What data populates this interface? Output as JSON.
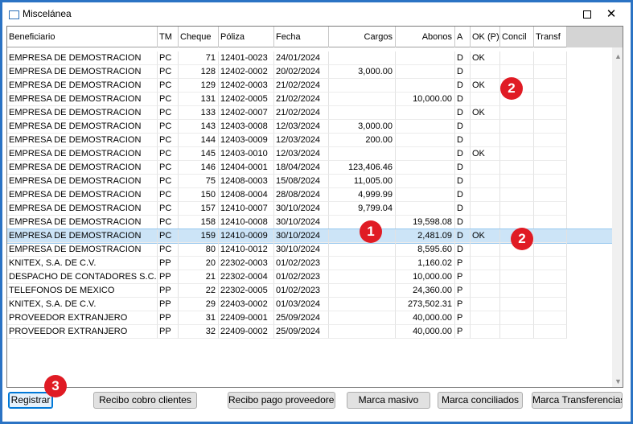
{
  "window": {
    "title": "Miscelánea",
    "maximize_icon": "maximize-icon",
    "close_label": "✕"
  },
  "table": {
    "columns": [
      "Beneficiario",
      "TM",
      "Cheque",
      "Póliza",
      "Fecha",
      "Cargos",
      "Abonos",
      "A",
      "OK (P)",
      "Concil",
      "Transf"
    ],
    "selected_row": 13,
    "rows": [
      {
        "beneficiario": "EMPRESA DE DEMOSTRACION",
        "tm": "PC",
        "cheque": "71",
        "poliza": "12401-0023",
        "fecha": "24/01/2024",
        "cargos": "",
        "abonos": "",
        "a": "D",
        "ok": "OK"
      },
      {
        "beneficiario": "EMPRESA DE DEMOSTRACION",
        "tm": "PC",
        "cheque": "128",
        "poliza": "12402-0002",
        "fecha": "20/02/2024",
        "cargos": "3,000.00",
        "abonos": "",
        "a": "D",
        "ok": ""
      },
      {
        "beneficiario": "EMPRESA DE DEMOSTRACION",
        "tm": "PC",
        "cheque": "129",
        "poliza": "12402-0003",
        "fecha": "21/02/2024",
        "cargos": "",
        "abonos": "",
        "a": "D",
        "ok": "OK"
      },
      {
        "beneficiario": "EMPRESA DE DEMOSTRACION",
        "tm": "PC",
        "cheque": "131",
        "poliza": "12402-0005",
        "fecha": "21/02/2024",
        "cargos": "",
        "abonos": "10,000.00",
        "a": "D",
        "ok": ""
      },
      {
        "beneficiario": "EMPRESA DE DEMOSTRACION",
        "tm": "PC",
        "cheque": "133",
        "poliza": "12402-0007",
        "fecha": "21/02/2024",
        "cargos": "",
        "abonos": "",
        "a": "D",
        "ok": "OK"
      },
      {
        "beneficiario": "EMPRESA DE DEMOSTRACION",
        "tm": "PC",
        "cheque": "143",
        "poliza": "12403-0008",
        "fecha": "12/03/2024",
        "cargos": "3,000.00",
        "abonos": "",
        "a": "D",
        "ok": ""
      },
      {
        "beneficiario": "EMPRESA DE DEMOSTRACION",
        "tm": "PC",
        "cheque": "144",
        "poliza": "12403-0009",
        "fecha": "12/03/2024",
        "cargos": "200.00",
        "abonos": "",
        "a": "D",
        "ok": ""
      },
      {
        "beneficiario": "EMPRESA DE DEMOSTRACION",
        "tm": "PC",
        "cheque": "145",
        "poliza": "12403-0010",
        "fecha": "12/03/2024",
        "cargos": "",
        "abonos": "",
        "a": "D",
        "ok": "OK"
      },
      {
        "beneficiario": "EMPRESA DE DEMOSTRACION",
        "tm": "PC",
        "cheque": "146",
        "poliza": "12404-0001",
        "fecha": "18/04/2024",
        "cargos": "123,406.46",
        "abonos": "",
        "a": "D",
        "ok": ""
      },
      {
        "beneficiario": "EMPRESA DE DEMOSTRACION",
        "tm": "PC",
        "cheque": "75",
        "poliza": "12408-0003",
        "fecha": "15/08/2024",
        "cargos": "11,005.00",
        "abonos": "",
        "a": "D",
        "ok": ""
      },
      {
        "beneficiario": "EMPRESA DE DEMOSTRACION",
        "tm": "PC",
        "cheque": "150",
        "poliza": "12408-0004",
        "fecha": "28/08/2024",
        "cargos": "4,999.99",
        "abonos": "",
        "a": "D",
        "ok": ""
      },
      {
        "beneficiario": "EMPRESA DE DEMOSTRACION",
        "tm": "PC",
        "cheque": "157",
        "poliza": "12410-0007",
        "fecha": "30/10/2024",
        "cargos": "9,799.04",
        "abonos": "",
        "a": "D",
        "ok": ""
      },
      {
        "beneficiario": "EMPRESA DE DEMOSTRACION",
        "tm": "PC",
        "cheque": "158",
        "poliza": "12410-0008",
        "fecha": "30/10/2024",
        "cargos": "",
        "abonos": "19,598.08",
        "a": "D",
        "ok": ""
      },
      {
        "beneficiario": "EMPRESA DE DEMOSTRACION",
        "tm": "PC",
        "cheque": "159",
        "poliza": "12410-0009",
        "fecha": "30/10/2024",
        "cargos": "",
        "abonos": "2,481.09",
        "a": "D",
        "ok": "OK"
      },
      {
        "beneficiario": "EMPRESA DE DEMOSTRACION",
        "tm": "PC",
        "cheque": "80",
        "poliza": "12410-0012",
        "fecha": "30/10/2024",
        "cargos": "",
        "abonos": "8,595.60",
        "a": "D",
        "ok": ""
      },
      {
        "beneficiario": "KNITEX, S.A. DE C.V.",
        "tm": "PP",
        "cheque": "20",
        "poliza": "22302-0003",
        "fecha": "01/02/2023",
        "cargos": "",
        "abonos": "1,160.02",
        "a": "P",
        "ok": ""
      },
      {
        "beneficiario": "DESPACHO DE CONTADORES S.C.",
        "tm": "PP",
        "cheque": "21",
        "poliza": "22302-0004",
        "fecha": "01/02/2023",
        "cargos": "",
        "abonos": "10,000.00",
        "a": "P",
        "ok": ""
      },
      {
        "beneficiario": "TELEFONOS DE MEXICO",
        "tm": "PP",
        "cheque": "22",
        "poliza": "22302-0005",
        "fecha": "01/02/2023",
        "cargos": "",
        "abonos": "24,360.00",
        "a": "P",
        "ok": ""
      },
      {
        "beneficiario": "KNITEX, S.A. DE C.V.",
        "tm": "PP",
        "cheque": "29",
        "poliza": "22403-0002",
        "fecha": "01/03/2024",
        "cargos": "",
        "abonos": "273,502.31",
        "a": "P",
        "ok": ""
      },
      {
        "beneficiario": "PROVEEDOR EXTRANJERO",
        "tm": "PP",
        "cheque": "31",
        "poliza": "22409-0001",
        "fecha": "25/09/2024",
        "cargos": "",
        "abonos": "40,000.00",
        "a": "P",
        "ok": ""
      },
      {
        "beneficiario": "PROVEEDOR EXTRANJERO",
        "tm": "PP",
        "cheque": "32",
        "poliza": "22409-0002",
        "fecha": "25/09/2024",
        "cargos": "",
        "abonos": "40,000.00",
        "a": "P",
        "ok": ""
      }
    ]
  },
  "buttons": {
    "registrar": "Registrar",
    "recibo_cobro": "Recibo cobro clientes",
    "recibo_pago": "Recibo pago proveedores",
    "marca_masivo": "Marca masivo",
    "marca_conciliados": "Marca conciliados",
    "marca_transferencias": "Marca Transferencias"
  },
  "annotations": {
    "badge_1": "1",
    "badge_2a": "2",
    "badge_2b": "2",
    "badge_3": "3",
    "color": "#e01b24"
  },
  "colors": {
    "frame": "#2b73c4",
    "selection": "#cce4f7"
  }
}
